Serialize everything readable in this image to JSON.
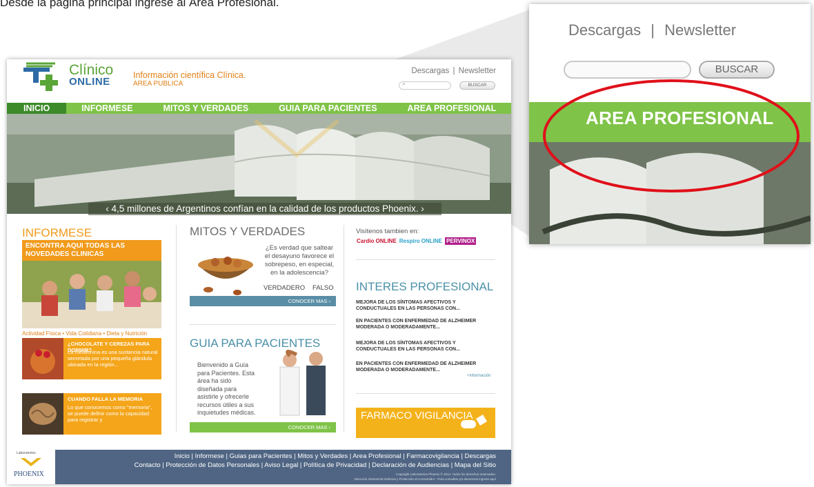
{
  "instruction": "Desde la página principal ingrese al Área Profesional.",
  "site": {
    "logo_line1": "Clínico",
    "logo_line2": "ONLINE",
    "tagline": "Información científica Clínica.",
    "tagline_sub": "AREA PUBLICA",
    "top_links": "Descargas   |   Newsletter",
    "search_button": "BUSCAR",
    "nav": [
      "INICIO",
      "INFORMESE",
      "MITOS Y VERDADES",
      "GUIA PARA PACIENTES",
      "AREA PROFESIONAL"
    ],
    "hero_caption": "‹  4,5 millones de Argentinos confían en la calidad de los productos Phoenix.  ›",
    "informese": {
      "title": "INFORMESE",
      "banner": "ENCONTRA AQUI TODAS LAS NOVEDADES CLINICAS",
      "links": "Actividad Física • Vida Cotidiana • Dieta y Nutrición",
      "promo1_title": "¿CHOCOLATE Y CEREZAS PARA DORMIR?",
      "promo1_desc": "La melatonina es una sustancia natural secretada por una pequeña glándula ubicada en la región...",
      "promo2_title": "CUANDO FALLA LA MEMORIA",
      "promo2_desc": "Lo que conocemos como \"memoria\", se puede definir como la capacidad para registrar y"
    },
    "mitos": {
      "title": "MITOS Y VERDADES",
      "question": "¿Es verdad que saltear el desayuno favorece el sobrepeso, en especial, en la adolescencia?",
      "true_label": "VERDADERO",
      "false_label": "FALSO",
      "more": "CONOCER MAS ›"
    },
    "guia": {
      "title": "GUIA PARA PACIENTES",
      "text": "Bienvenido a Guía para Pacientes. Esta área ha sido diseñada para asistirle y ofrecerle recursos útiles a sus inquietudes médicas.",
      "more": "CONOCER MAS ›"
    },
    "right": {
      "visit": "Visítenos tambien en:",
      "brands": [
        "Cardio ONLINE",
        "Respiro ONLINE",
        "PERVINOX"
      ],
      "interes_title": "INTERES PROFESIONAL",
      "interes_items": [
        "MEJORA DE LOS SÍNTOMAS AFECTIVOS Y CONDUCTUALES EN LAS PERSONAS CON...",
        "EN PACIENTES CON ENFERMEDAD DE ALZHEIMER MODERADA O MODERADAMENTE...",
        "MEJORA DE LOS SÍNTOMAS AFECTIVOS Y CONDUCTUALES EN LAS PERSONAS CON...",
        "EN PACIENTES CON ENFERMEDAD DE ALZHEIMER MODERADA O MODERADAMENTE..."
      ],
      "info_link": "+información",
      "farmaco": "FARMACO VIGILANCIA"
    },
    "footer": {
      "logo_top": "Laboratorios",
      "logo_name": "PHOENIX",
      "row1": "Inicio  |  Informese  |  Guias para Pacientes  |  Mitos y Verdades  |  Area Profesional  |  Farmacovigilancia  |  Descargas",
      "row2": "Contacto  |  Protección de Datos Personales  |  Aviso Legal  |  Política de Privacidad  |  Declaración de Audiencias  |  Mapa del Sitio",
      "copy1": "Copyright Laboratorios Phoenix © 2014. Todos los derechos reservados.",
      "copy2": "Dirección General de Defensa y Protección al Consumidor - Para consultas y/o denuncias ingrese aquí"
    }
  },
  "zoom": {
    "links": "Descargas   |   Newsletter",
    "search_button": "BUSCAR",
    "highlight": "AREA PROFESIONAL"
  },
  "colors": {
    "nav_green": "#7fc348",
    "accent_orange": "#f19a1b",
    "highlight_red": "#e0101a",
    "footer_blue": "#4f6583"
  }
}
